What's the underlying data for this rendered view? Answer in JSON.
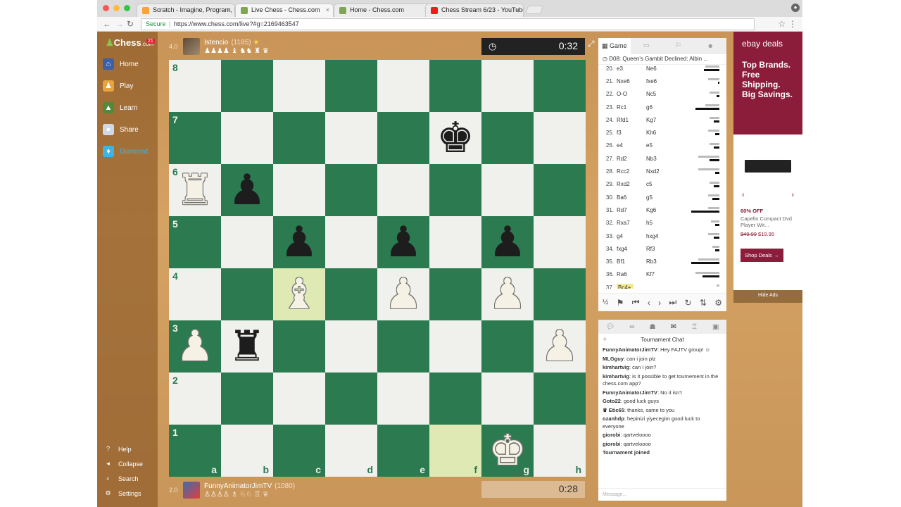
{
  "browser": {
    "tabs": [
      {
        "title": "Scratch - Imagine, Program, S",
        "fav_color": "#f7a33b"
      },
      {
        "title": "Live Chess - Chess.com",
        "fav_color": "#7fa650"
      },
      {
        "title": "Home - Chess.com",
        "fav_color": "#7fa650"
      },
      {
        "title": "Chess Stream 6/23 - YouTube",
        "fav_color": "#e62117"
      }
    ],
    "secure_label": "Secure",
    "url": "https://www.chess.com/live?#g=2169463547"
  },
  "sidebar": {
    "logo_text": "Chess",
    "logo_suffix": ".com",
    "badge": "21",
    "items": [
      {
        "label": "Home",
        "icon": "house-icon"
      },
      {
        "label": "Play",
        "icon": "pawn-icon"
      },
      {
        "label": "Learn",
        "icon": "graduation-icon"
      },
      {
        "label": "Share",
        "icon": "chat-bubble-icon"
      },
      {
        "label": "Diamond",
        "icon": "diamond-icon"
      }
    ],
    "bottom": [
      {
        "label": "Help",
        "icon": "help-icon"
      },
      {
        "label": "Collapse",
        "icon": "collapse-icon"
      },
      {
        "label": "Search",
        "icon": "search-icon"
      },
      {
        "label": "Settings",
        "icon": "gear-icon"
      }
    ]
  },
  "top_player": {
    "score": "4.0",
    "name": "Istencio",
    "rating": "(1185)",
    "captures": "♟♟♟♟ ♝ ♞♞ ♜ ♛",
    "clock": "0:32"
  },
  "bottom_player": {
    "score": "2.0",
    "name": "FunnyAnimatorJimTV",
    "rating": "(1080)",
    "captures": "♙♙♙♙ ♗ ♘♘ ♖ ♕",
    "clock": "0:28"
  },
  "board": {
    "ranks": [
      "8",
      "7",
      "6",
      "5",
      "4",
      "3",
      "2",
      "1"
    ],
    "files": [
      "a",
      "b",
      "c",
      "d",
      "e",
      "f",
      "g",
      "h"
    ],
    "highlight": [
      "c4",
      "f1"
    ],
    "pieces": {
      "f7": "bk",
      "a6": "wr",
      "b6": "bp",
      "c5": "bp",
      "e5": "bp",
      "g5": "bp",
      "c4": "wb",
      "e4": "wp",
      "g4": "wp",
      "a3": "wp",
      "b3": "br",
      "h3": "wp",
      "g1": "wk"
    }
  },
  "game_panel": {
    "tab_label": "Game",
    "opening": "D08: Queen's Gambit Declined: Albin ...",
    "moves": [
      {
        "n": "20.",
        "w": "e3",
        "b": "Ne6",
        "g": 20,
        "k": 22
      },
      {
        "n": "21.",
        "w": "Nxe6",
        "b": "fxe6",
        "g": 16,
        "k": 2
      },
      {
        "n": "22.",
        "w": "O-O",
        "b": "Nc5",
        "g": 14,
        "k": 4
      },
      {
        "n": "23.",
        "w": "Rc1",
        "b": "g6",
        "g": 20,
        "k": 34
      },
      {
        "n": "24.",
        "w": "Rfd1",
        "b": "Kg7",
        "g": 14,
        "k": 8
      },
      {
        "n": "25.",
        "w": "f3",
        "b": "Kh6",
        "g": 16,
        "k": 6
      },
      {
        "n": "26.",
        "w": "e4",
        "b": "e5",
        "g": 14,
        "k": 8
      },
      {
        "n": "27.",
        "w": "Rd2",
        "b": "Nb3",
        "g": 30,
        "k": 14
      },
      {
        "n": "28.",
        "w": "Rcc2",
        "b": "Nxd2",
        "g": 30,
        "k": 6
      },
      {
        "n": "29.",
        "w": "Rxd2",
        "b": "c5",
        "g": 14,
        "k": 8
      },
      {
        "n": "30.",
        "w": "Ba6",
        "b": "g5",
        "g": 16,
        "k": 10
      },
      {
        "n": "31.",
        "w": "Rd7",
        "b": "Kg6",
        "g": 16,
        "k": 40
      },
      {
        "n": "32.",
        "w": "Rxa7",
        "b": "h5",
        "g": 12,
        "k": 6
      },
      {
        "n": "33.",
        "w": "g4",
        "b": "hxg4",
        "g": 16,
        "k": 8
      },
      {
        "n": "34.",
        "w": "fxg4",
        "b": "Rf3",
        "g": 10,
        "k": 6
      },
      {
        "n": "35.",
        "w": "Bf1",
        "b": "Rb3",
        "g": 30,
        "k": 40
      },
      {
        "n": "36.",
        "w": "Ra6",
        "b": "Kf7",
        "g": 34,
        "k": 24
      },
      {
        "n": "37.",
        "w": "Bc4+",
        "b": "",
        "g": 4,
        "k": 0
      }
    ],
    "draw_label": "½"
  },
  "chat": {
    "title": "Tournament Chat",
    "messages": [
      {
        "user": "FunnyAnimatorJimTV",
        "text": "Hey FAJTV group! ☺"
      },
      {
        "user": "MLGguy",
        "text": "can i join plz"
      },
      {
        "user": "kimhartvig",
        "text": "can I join?"
      },
      {
        "user": "kimhartvig",
        "text": "is it possible to get tournement in the chess.com app?"
      },
      {
        "user": "FunnyAnimatorJimTV",
        "text": "No it isn't"
      },
      {
        "user": "Goto22",
        "text": "good luck guys"
      },
      {
        "user": "♛ Etic65",
        "text": "thanks, same to you"
      },
      {
        "user": "ozanhdp",
        "text": "hepinizi yiyecegim good luck to everyone"
      },
      {
        "user": "giorobi",
        "text": "qartveloooo"
      },
      {
        "user": "giorobi",
        "text": "qartveloooo"
      },
      {
        "user": "Tournament joined",
        "text": ""
      }
    ],
    "input_placeholder": "Message..."
  },
  "ad": {
    "logo": "ebay deals",
    "headline": "Top Brands. Free Shipping. Big Savings.",
    "discount": "60% OFF",
    "product": "Capello Compact Dvd Player Wit...",
    "old_price": "$49.99",
    "new_price": "$19.95",
    "button": "Shop Deals →",
    "hide": "Hide Ads"
  }
}
